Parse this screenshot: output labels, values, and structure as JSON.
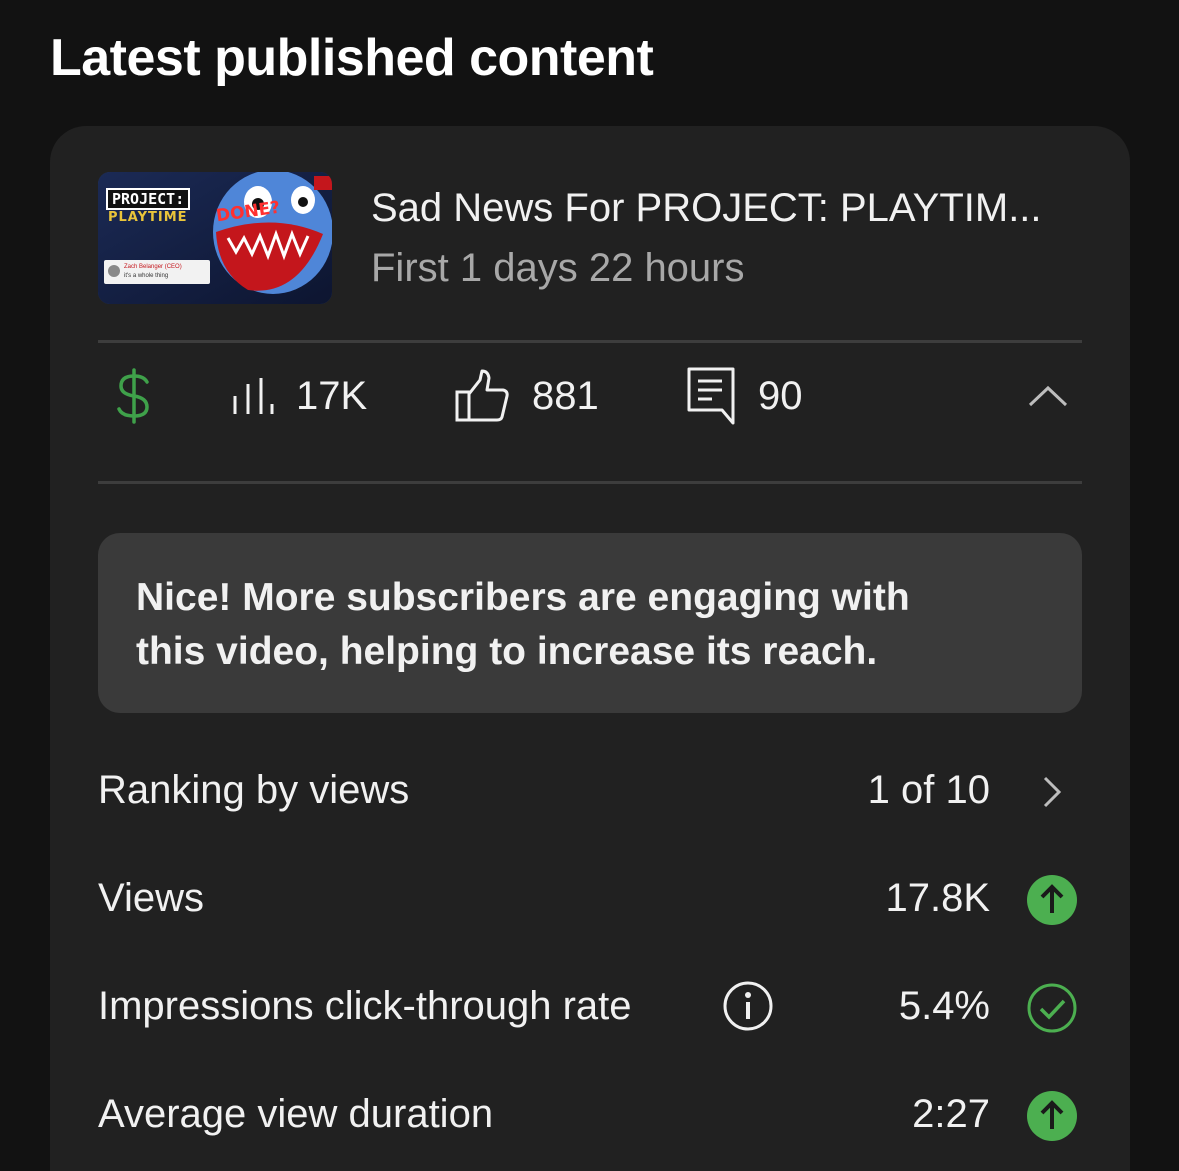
{
  "section": {
    "title": "Latest published content"
  },
  "video": {
    "title": "Sad News For PROJECT: PLAYTIM...",
    "subtitle": "First 1 days 22 hours",
    "thumbnail": {
      "top_text": "PROJECT:",
      "logo_text": "PLAYTIME",
      "badge_text": "DONE?",
      "caption_name": "Zach Belanger (CEO)",
      "caption_sub": "it's a whole thing"
    }
  },
  "stats": {
    "views": "17K",
    "likes": "881",
    "comments": "90"
  },
  "insight": {
    "line1": "Nice! More subscribers are engaging with",
    "line2": "this video, helping to increase its reach."
  },
  "metrics": [
    {
      "label": "Ranking by views",
      "value": "1 of 10",
      "status": "chevron"
    },
    {
      "label": "Views",
      "value": "17.8K",
      "status": "up"
    },
    {
      "label": "Impressions click-through rate",
      "value": "5.4%",
      "status": "check"
    },
    {
      "label": "Average view duration",
      "value": "2:27",
      "status": "up"
    }
  ],
  "colors": {
    "background": "#121212",
    "card": "#212121",
    "insight_box": "#3a3a3a",
    "accent_green": "#4caf50",
    "monetization_green": "#3fa14a",
    "secondary_text": "#a8a8a8"
  },
  "icons": {
    "monetization": "dollar-icon",
    "views": "bar-chart-icon",
    "likes": "thumbs-up-icon",
    "comments": "comment-icon",
    "collapse": "chevron-up-icon",
    "ranking": "chevron-right-icon",
    "trend_up": "arrow-up-circle-icon",
    "ok": "check-circle-icon",
    "info": "info-icon"
  }
}
